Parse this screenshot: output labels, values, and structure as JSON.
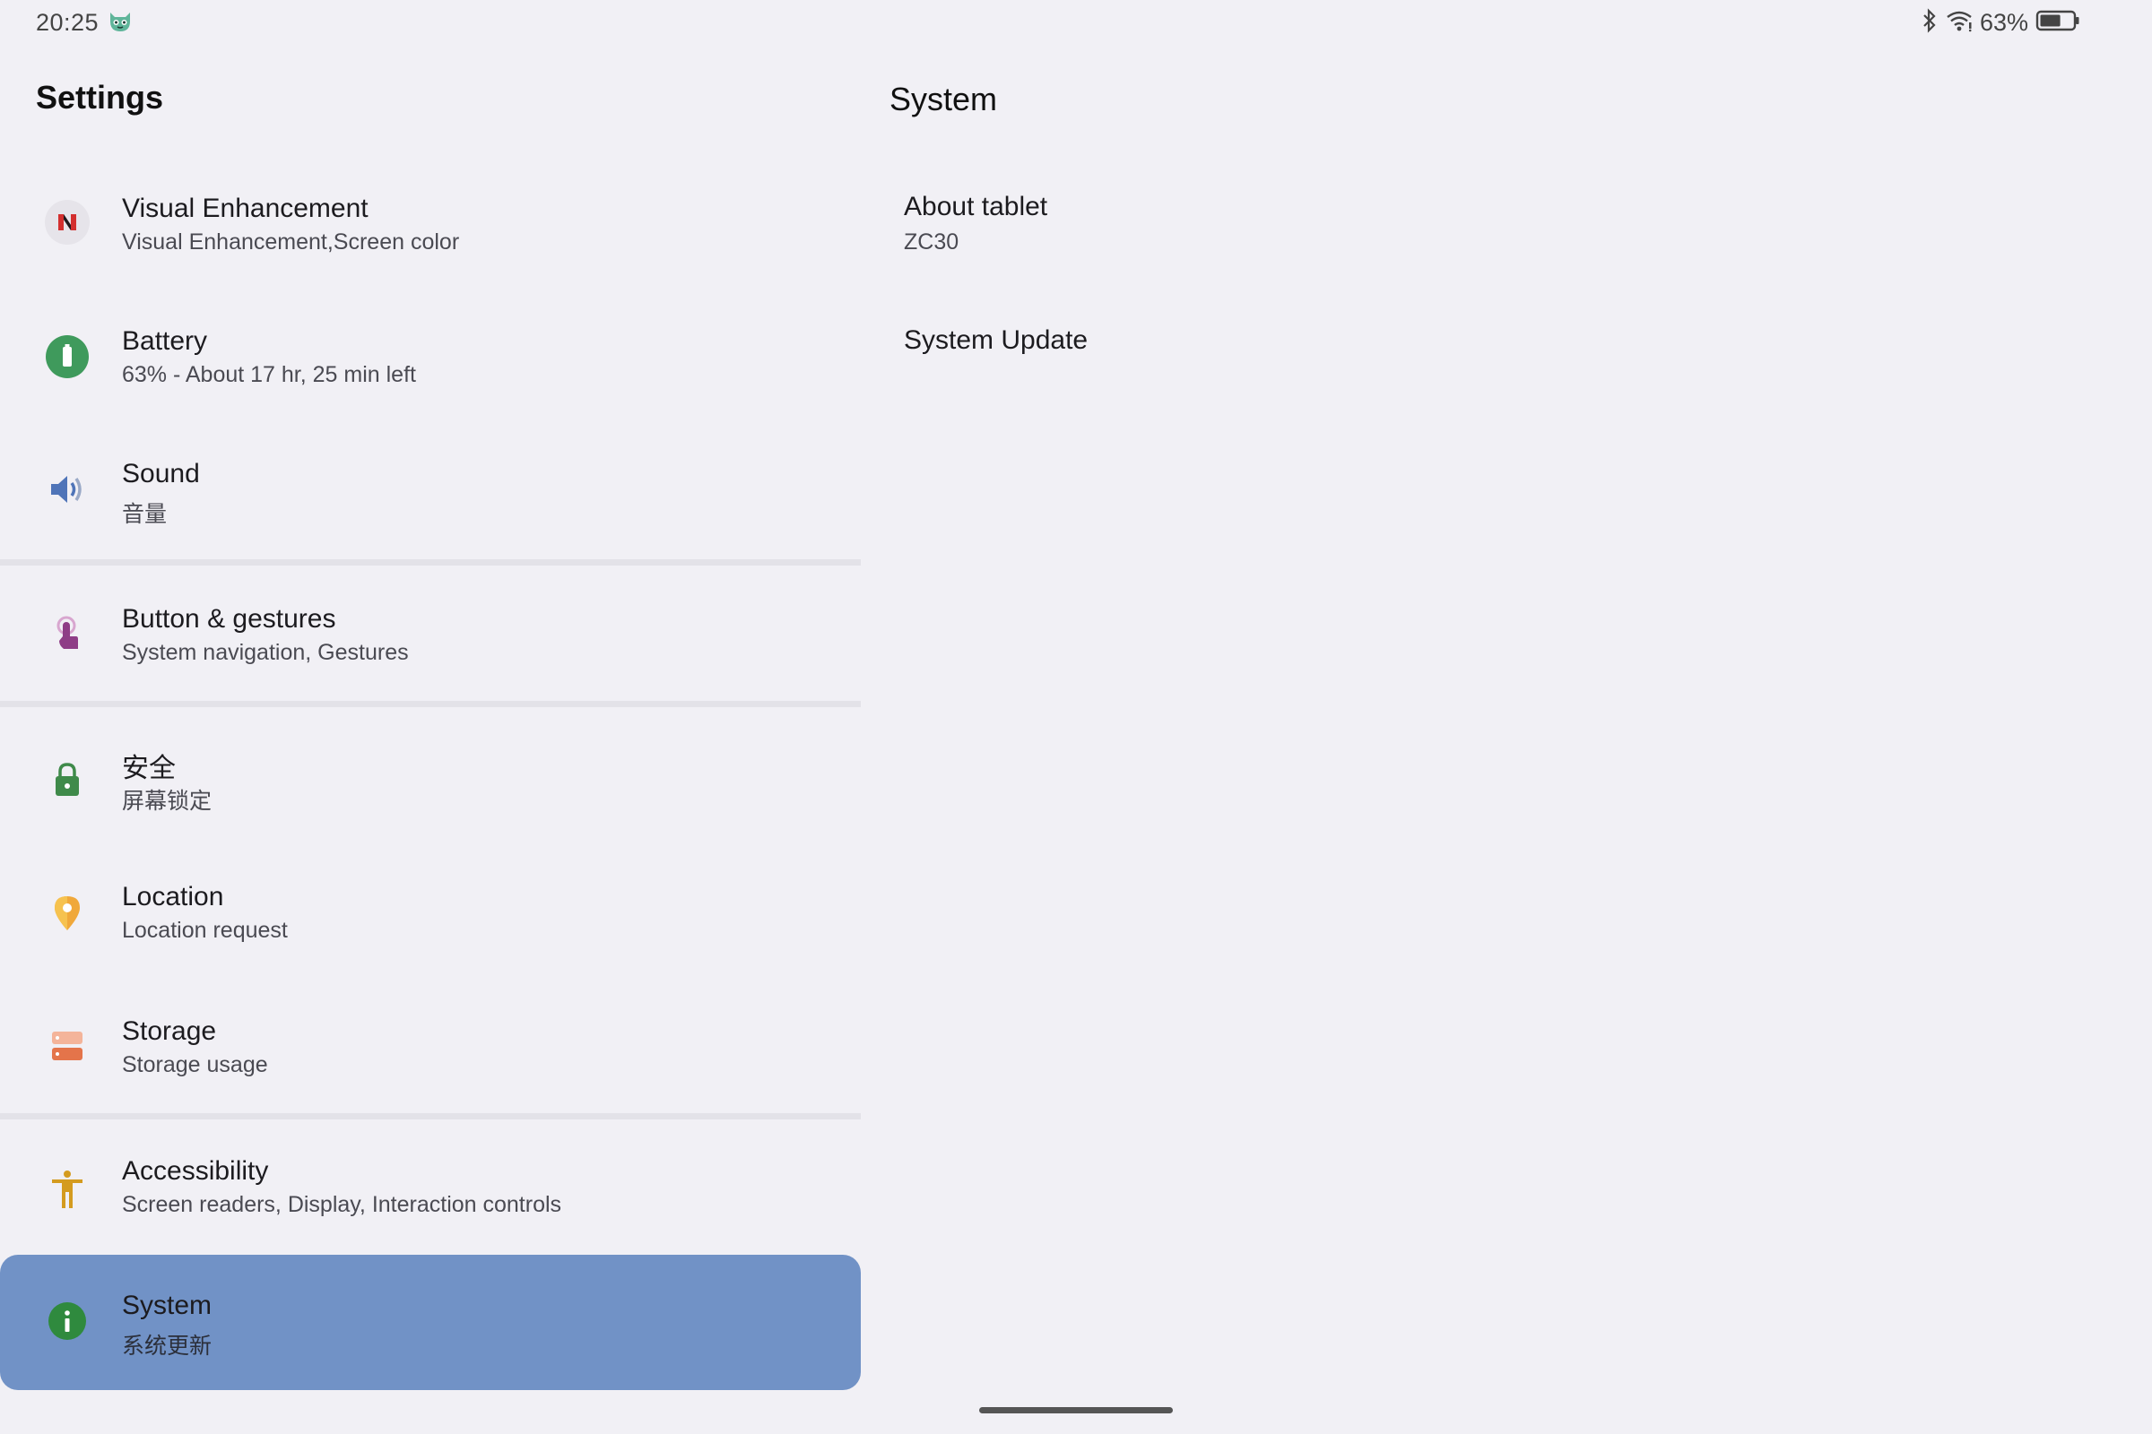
{
  "status_bar": {
    "time": "20:25",
    "notification_icon": "cat-face-icon",
    "battery_percent_text": "63%",
    "battery_level": 0.63,
    "icons": [
      "bluetooth-icon",
      "wifi-icon",
      "battery-icon"
    ]
  },
  "left": {
    "title": "Settings",
    "items": [
      {
        "title": "Visual Enhancement",
        "summary": "Visual Enhancement,Screen color",
        "icon": "visual-enhancement-icon"
      },
      {
        "title": "Battery",
        "summary": "63% - About 17 hr, 25 min left",
        "icon": "battery-icon"
      },
      {
        "title": "Sound",
        "summary": "音量",
        "icon": "speaker-icon"
      },
      {
        "title": "Button & gestures",
        "summary": "System navigation, Gestures",
        "icon": "touch-gesture-icon"
      },
      {
        "title": "安全",
        "summary": "屏幕锁定",
        "icon": "lock-icon"
      },
      {
        "title": "Location",
        "summary": "Location request",
        "icon": "location-pin-icon"
      },
      {
        "title": "Storage",
        "summary": "Storage usage",
        "icon": "storage-icon"
      },
      {
        "title": "Accessibility",
        "summary": "Screen readers, Display, Interaction controls",
        "icon": "accessibility-icon"
      },
      {
        "title": "System",
        "summary": "系统更新",
        "icon": "info-icon"
      }
    ],
    "selected_index": 8
  },
  "right": {
    "title": "System",
    "items": [
      {
        "title": "About tablet",
        "summary": "ZC30"
      },
      {
        "title": "System Update"
      }
    ]
  },
  "colors": {
    "background": "#f1f0f5",
    "selected_row": "#7192c6",
    "divider": "#e3e2e8"
  }
}
